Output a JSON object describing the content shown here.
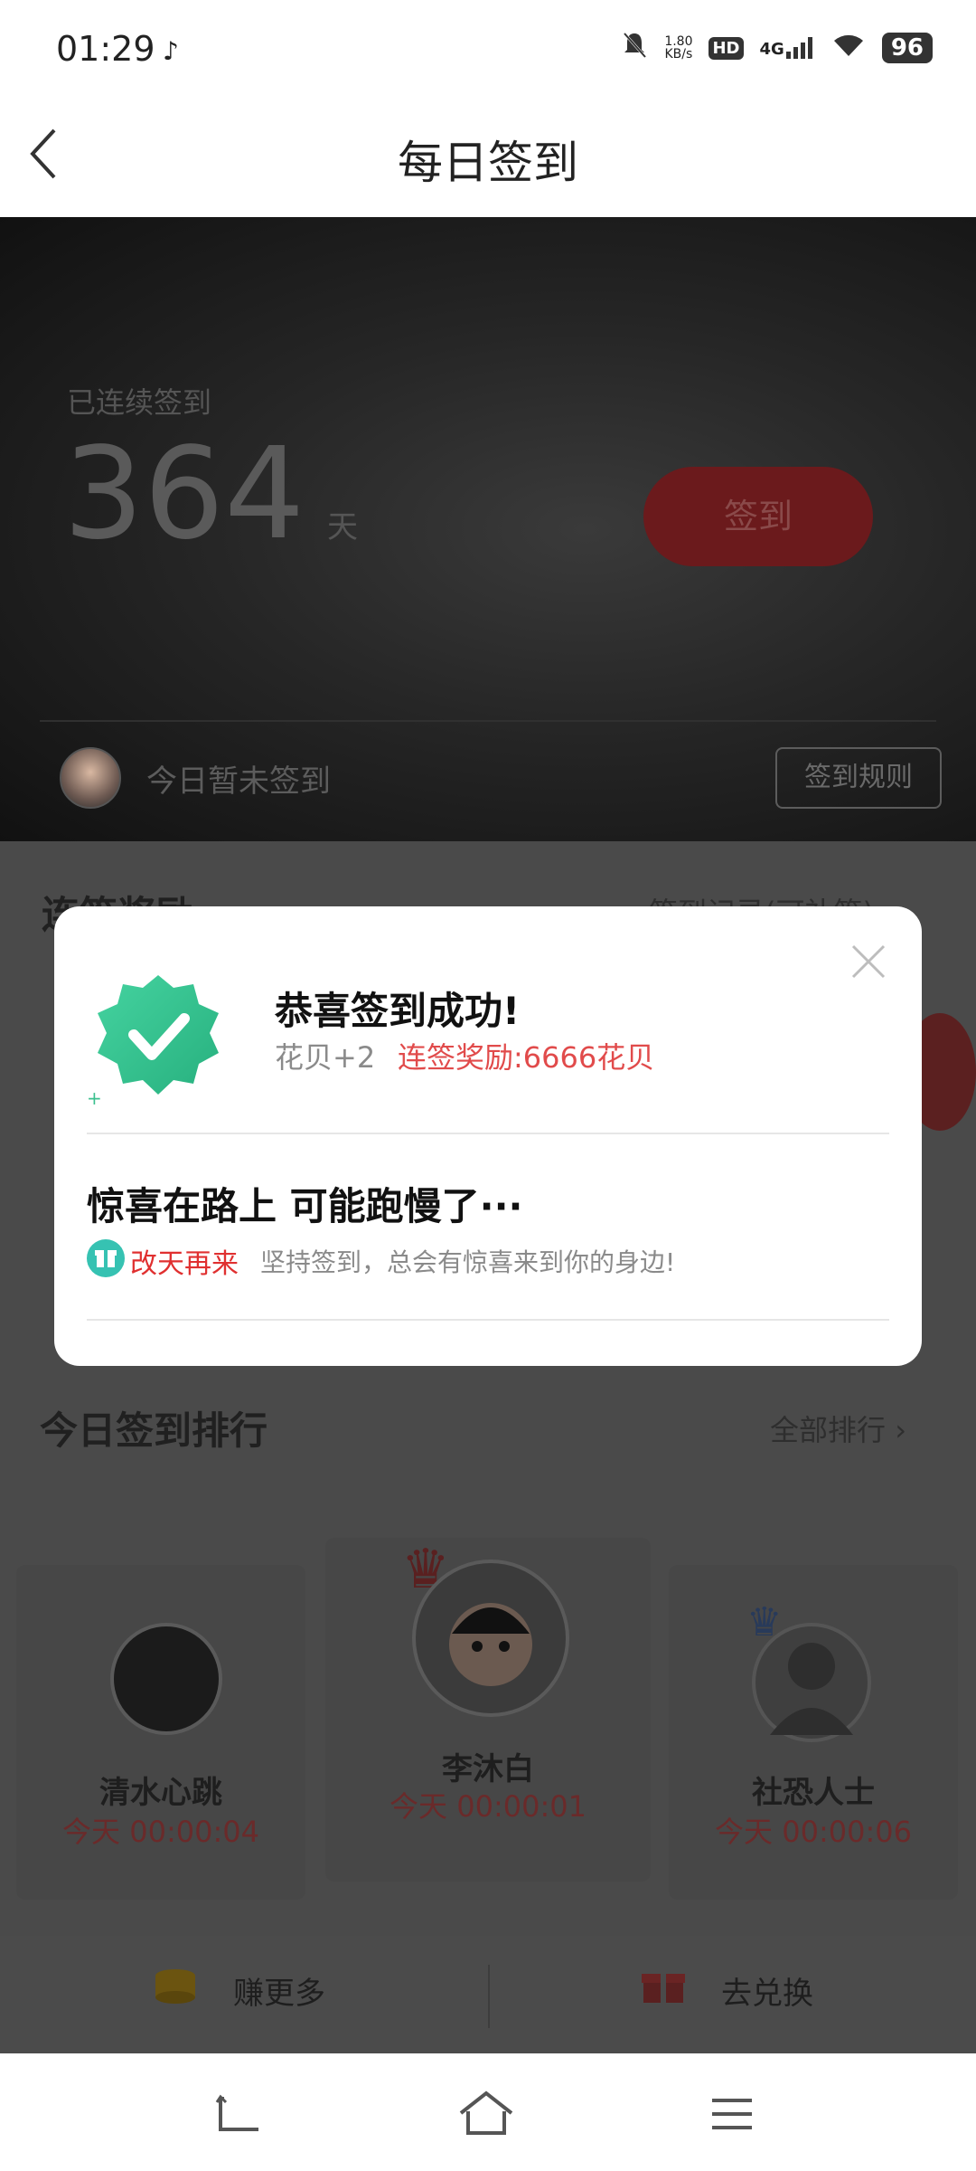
{
  "status_bar": {
    "time": "01:29",
    "net_speed_value": "1.80",
    "net_speed_unit": "KB/s",
    "hd": "HD",
    "network": "4G",
    "battery": "96"
  },
  "navbar": {
    "title": "每日签到"
  },
  "hero": {
    "consecutive_label": "已连续签到",
    "days": "364",
    "unit": "天",
    "sign_button": "签到",
    "today_status": "今日暂未签到",
    "rules_button": "签到规则"
  },
  "sections": {
    "streak_title": "连签奖励",
    "streak_link": "签到记录(可补签)",
    "ranking_title": "今日签到排行",
    "ranking_link": "全部排行"
  },
  "ranking": [
    {
      "name": "清水心跳",
      "time": "今天 00:00:04"
    },
    {
      "name": "李沐白",
      "time": "今天 00:00:01"
    },
    {
      "name": "社恐人士",
      "time": "今天 00:00:06"
    }
  ],
  "bottom_bar": {
    "earn_more": "赚更多",
    "redeem": "去兑换"
  },
  "modal": {
    "title": "恭喜签到成功!",
    "points": "花贝+2",
    "streak_reward": "连签奖励:6666花贝",
    "surprise_title": "惊喜在路上 可能跑慢了···",
    "come_back": "改天再来",
    "tip": "坚持签到，总会有惊喜来到你的身边!"
  },
  "colors": {
    "accent_red": "#e14b4b",
    "badge_green": "#3cc08f",
    "gift_teal": "#36c2b2"
  }
}
